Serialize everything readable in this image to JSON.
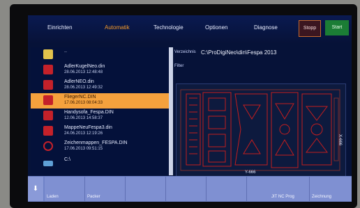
{
  "menu": {
    "items": [
      "Einrichten",
      "Automatik",
      "Technologie",
      "Optionen",
      "Diagnose"
    ],
    "active": "Automatik",
    "stop_label": "Stopp",
    "start_label": "Start"
  },
  "files": [
    {
      "name": "..",
      "date": "",
      "icon": "folder-up-icon"
    },
    {
      "name": "AdlerKugelNeo.din",
      "date": "28.06.2013 12:48:48",
      "icon": "file-icon"
    },
    {
      "name": "AdlerNEO.din",
      "date": "28.06.2013 12:49:32",
      "icon": "file-icon"
    },
    {
      "name": "FliegerNC.DIN",
      "date": "17.06.2013 08:04:33",
      "icon": "file-icon",
      "selected": true
    },
    {
      "name": "Handysofa_Fespa.DIN",
      "date": "12.06.2013 14:58:37",
      "icon": "file-icon"
    },
    {
      "name": "MappeNeuFespa3.din",
      "date": "24.06.2013 12:19:26",
      "icon": "file-icon"
    },
    {
      "name": "Zeichenmappen_FESPA.DIN",
      "date": "17.06.2013 09:51:15",
      "icon": "link-icon"
    },
    {
      "name": "C:\\",
      "date": "",
      "icon": "drive-icon"
    }
  ],
  "directory": {
    "label": "Verzeichnis",
    "value": "C:\\ProDigiNeo\\din\\Fespa 2013",
    "filter_label": "Filter"
  },
  "preview": {
    "x_label": "Y-666",
    "y_label": "X-666"
  },
  "toolbar": {
    "arrow": "⬇",
    "buttons": [
      "Laden",
      "Packer",
      "",
      "",
      "",
      "",
      "JIT NC Prog",
      "Zeichnung"
    ]
  },
  "colors": {
    "accent": "#f5a13d",
    "background": "#061238",
    "toolbar": "#6f82c8",
    "drawing": "#c41e1e",
    "stop": "#3b1620",
    "start": "#1b7d35"
  }
}
